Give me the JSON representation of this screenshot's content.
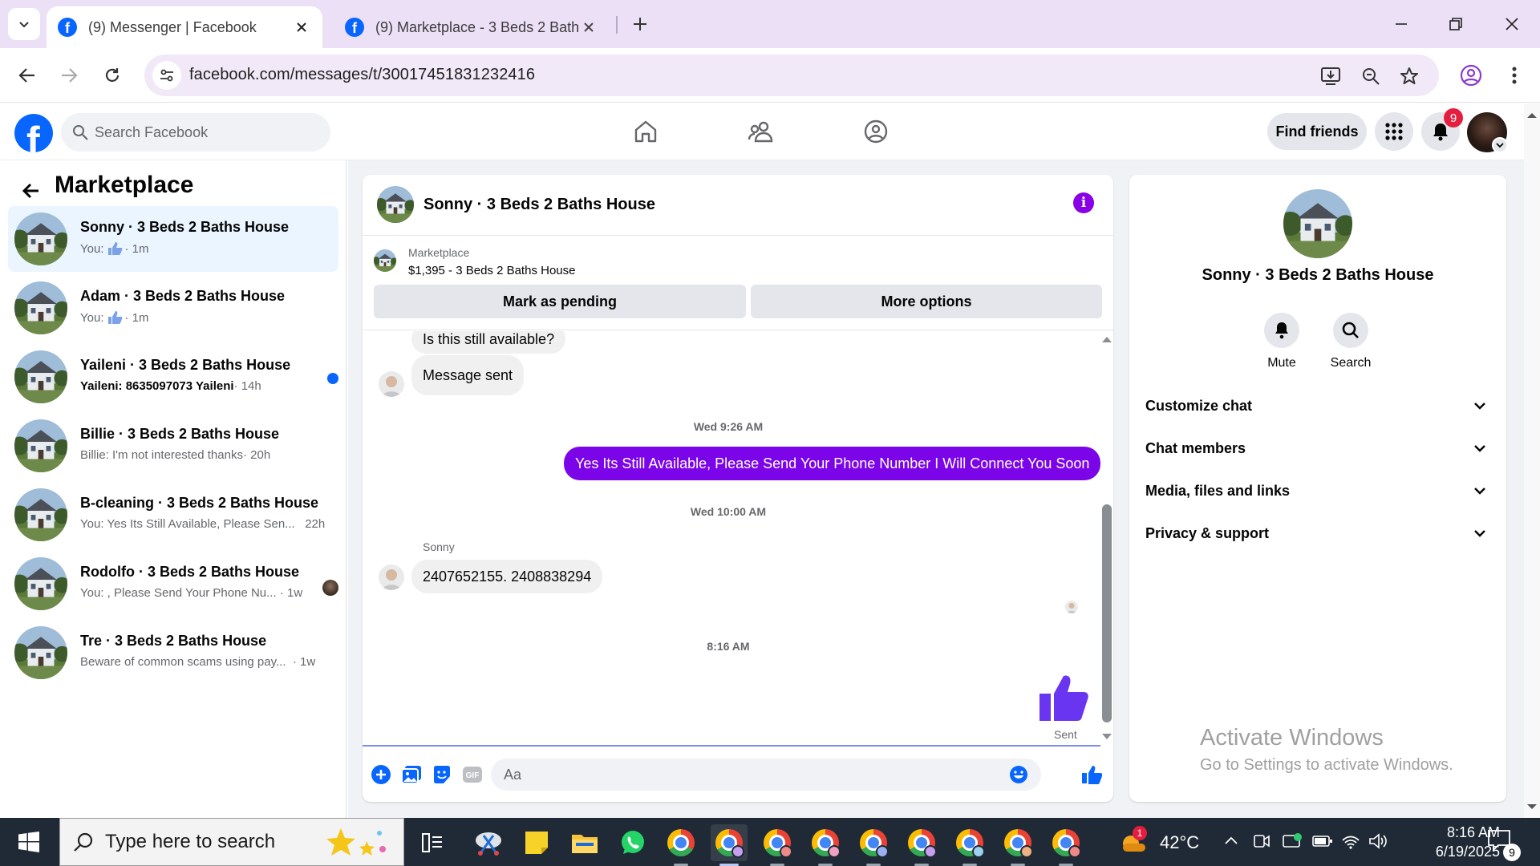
{
  "browser": {
    "tabs": [
      {
        "title": "(9) Messenger | Facebook",
        "active": true
      },
      {
        "title": "(9) Marketplace - 3 Beds 2 Bath",
        "active": false
      }
    ],
    "url": "facebook.com/messages/t/30017451831232416"
  },
  "fb": {
    "search_placeholder": "Search Facebook",
    "find_friends": "Find friends",
    "notification_count": "9"
  },
  "marketplace": {
    "title": "Marketplace",
    "conversations": [
      {
        "name": "Sonny · 3 Beds 2 Baths House",
        "prefix": "You:",
        "like": true,
        "preview": "",
        "time": "· 1m",
        "active": true
      },
      {
        "name": "Adam · 3 Beds 2 Baths House",
        "prefix": "You:",
        "like": true,
        "preview": "",
        "time": "· 1m"
      },
      {
        "name": "Yaileni · 3 Beds 2 Baths House",
        "prefix": "",
        "preview": "Yaileni: 8635097073 Yaileni",
        "time": " · 14h",
        "unread": true
      },
      {
        "name": "Billie · 3 Beds 2 Baths House",
        "prefix": "",
        "preview": "Billie: I'm not interested thanks",
        "time": " · 20h"
      },
      {
        "name": "B-cleaning · 3 Beds 2 Baths House",
        "prefix": "",
        "preview": "You: Yes Its Still Available, Please Sen...",
        "time": "   22h"
      },
      {
        "name": "Rodolfo · 3 Beds 2 Baths House",
        "prefix": "",
        "preview": "You: , Please Send Your Phone Nu...",
        "time": " · 1w",
        "seen": true
      },
      {
        "name": "Tre · 3 Beds 2 Baths House",
        "prefix": "",
        "preview": "Beware of common scams using pay...",
        "time": "  · 1w"
      }
    ]
  },
  "chat": {
    "title": "Sonny · 3 Beds 2 Baths House",
    "listing_source": "Marketplace",
    "listing_price": "$1,395 - 3 Beds 2 Baths House",
    "mark_pending": "Mark as pending",
    "more_options": "More options",
    "messages": {
      "m1": "Is this still available?",
      "m2": "Message sent",
      "t1": "Wed 9:26 AM",
      "m3": "Yes Its Still Available, Please Send Your Phone Number I Will Connect You Soon",
      "t2": "Wed 10:00 AM",
      "sender": "Sonny",
      "m4": "2407652155.  2408838294",
      "t3": "8:16 AM",
      "sent_label": "Sent"
    },
    "composer_placeholder": "Aa"
  },
  "info_panel": {
    "title": "Sonny · 3 Beds 2 Baths House",
    "mute": "Mute",
    "search": "Search",
    "rows": [
      "Customize chat",
      "Chat members",
      "Media, files and links",
      "Privacy & support"
    ]
  },
  "watermark": {
    "line1": "Activate Windows",
    "line2": "Go to Settings to activate Windows."
  },
  "taskbar": {
    "search_placeholder": "Type here to search",
    "weather_badge": "1",
    "temperature": "42°C",
    "time": "8:16 AM",
    "date": "6/19/2025",
    "notif_count": "9"
  },
  "colors": {
    "fb_blue": "#0866ff",
    "messenger_purple": "#7b05e8",
    "tab_strip": "#ece0f7",
    "taskbar": "#1f2a36"
  }
}
